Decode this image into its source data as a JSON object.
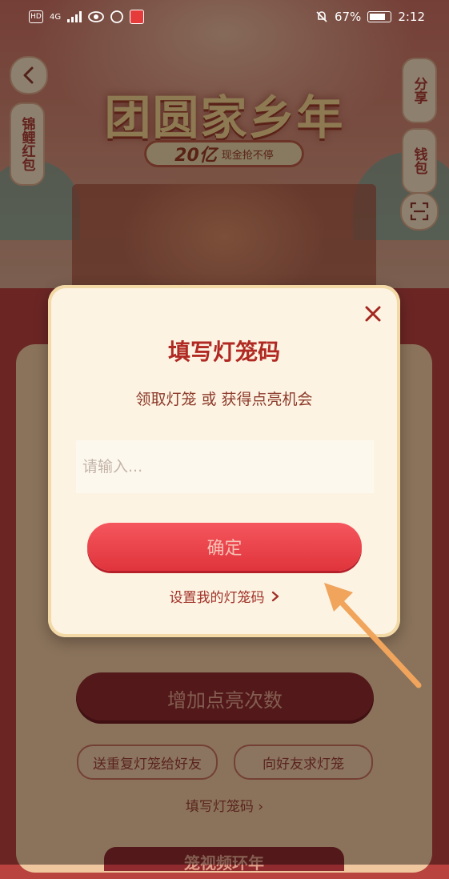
{
  "status_bar": {
    "left_labels": [
      "HD",
      "4G"
    ],
    "battery": "67%",
    "time": "2:12"
  },
  "background": {
    "title": "团圆家乡年",
    "subtitle_big": "20亿",
    "subtitle_small": "现金抢不停",
    "koi_label": "锦鲤红包",
    "share_label": "分享",
    "wallet_label": "钱包",
    "add_button": "增加点亮次数",
    "send_button": "送重复灯笼给好友",
    "ask_button": "向好友求灯笼",
    "fill_link": "填写灯笼码 ›",
    "bottom_bar": "笼视频环年"
  },
  "modal": {
    "title": "填写灯笼码",
    "subtitle": "领取灯笼 或 获得点亮机会",
    "input_placeholder": "请输入...",
    "input_value": "",
    "confirm_label": "确定",
    "set_link_label": "设置我的灯笼码"
  },
  "colors": {
    "accent_red": "#e0343c",
    "title_red": "#b02a23",
    "arrow_orange": "#f0a45c"
  },
  "icons": {
    "back": "chevron-left-icon",
    "scan": "scan-icon",
    "close": "close-icon",
    "arrow": "pointer-arrow-icon"
  }
}
